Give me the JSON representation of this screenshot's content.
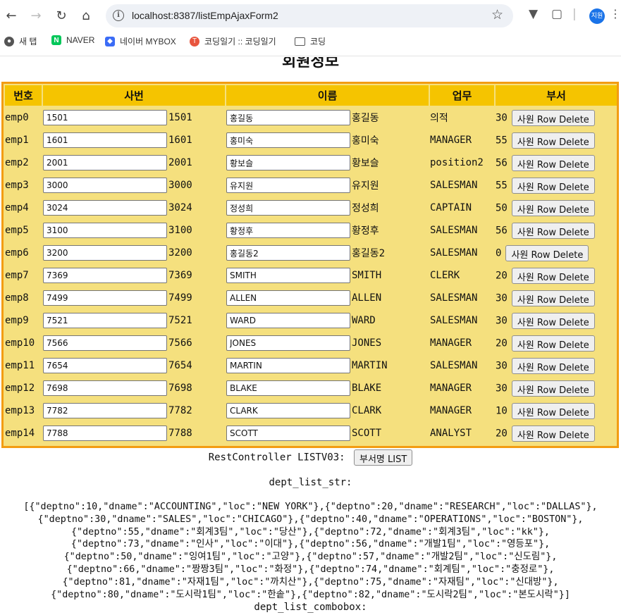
{
  "browser": {
    "url": "localhost:8387/listEmpAjaxForm2",
    "profile_label": "지원",
    "bookmarks": [
      {
        "label": "새 탭",
        "icon": "globe-icon"
      },
      {
        "label": "NAVER",
        "icon": "naver-icon"
      },
      {
        "label": "네이버 MYBOX",
        "icon": "mybox-icon"
      },
      {
        "label": "코딩일기 :: 코딩일기",
        "icon": "tistory-icon"
      },
      {
        "label": "코딩",
        "icon": "folder-icon"
      }
    ]
  },
  "page": {
    "title": "회원정보",
    "headers": [
      "번호",
      "사번",
      "이름",
      "업무",
      "부서"
    ],
    "delete_label": "사원 Row Delete",
    "rows": [
      {
        "no": "emp0",
        "empno": "1501",
        "ename": "홍길동",
        "job": "의적",
        "dept": "30"
      },
      {
        "no": "emp1",
        "empno": "1601",
        "ename": "홍미숙",
        "job": "MANAGER",
        "dept": "55"
      },
      {
        "no": "emp2",
        "empno": "2001",
        "ename": "황보슬",
        "job": "position2",
        "dept": "56"
      },
      {
        "no": "emp3",
        "empno": "3000",
        "ename": "유지원",
        "job": "SALESMAN",
        "dept": "55"
      },
      {
        "no": "emp4",
        "empno": "3024",
        "ename": "정성희",
        "job": "CAPTAIN",
        "dept": "50"
      },
      {
        "no": "emp5",
        "empno": "3100",
        "ename": "황정후",
        "job": "SALESMAN",
        "dept": "56"
      },
      {
        "no": "emp6",
        "empno": "3200",
        "ename": "홍길동2",
        "job": "SALESMAN",
        "dept": "0"
      },
      {
        "no": "emp7",
        "empno": "7369",
        "ename": "SMITH",
        "job": "CLERK",
        "dept": "20"
      },
      {
        "no": "emp8",
        "empno": "7499",
        "ename": "ALLEN",
        "job": "SALESMAN",
        "dept": "30"
      },
      {
        "no": "emp9",
        "empno": "7521",
        "ename": "WARD",
        "job": "SALESMAN",
        "dept": "30"
      },
      {
        "no": "emp10",
        "empno": "7566",
        "ename": "JONES",
        "job": "MANAGER",
        "dept": "20"
      },
      {
        "no": "emp11",
        "empno": "7654",
        "ename": "MARTIN",
        "job": "SALESMAN",
        "dept": "30"
      },
      {
        "no": "emp12",
        "empno": "7698",
        "ename": "BLAKE",
        "job": "MANAGER",
        "dept": "30"
      },
      {
        "no": "emp13",
        "empno": "7782",
        "ename": "CLARK",
        "job": "MANAGER",
        "dept": "10"
      },
      {
        "no": "emp14",
        "empno": "7788",
        "ename": "SCOTT",
        "job": "ANALYST",
        "dept": "20"
      }
    ],
    "rest_label": "RestController LISTV03:",
    "dept_button": "부서명 LIST",
    "dept_list_str_label": "dept_list_str:",
    "dept_list_str": "[{\"deptno\":10,\"dname\":\"ACCOUNTING\",\"loc\":\"NEW YORK\"},{\"deptno\":20,\"dname\":\"RESEARCH\",\"loc\":\"DALLAS\"},{\"deptno\":30,\"dname\":\"SALES\",\"loc\":\"CHICAGO\"},{\"deptno\":40,\"dname\":\"OPERATIONS\",\"loc\":\"BOSTON\"},{\"deptno\":55,\"dname\":\"회계3팀\",\"loc\":\"당산\"},{\"deptno\":72,\"dname\":\"회계3팀\",\"loc\":\"kk\"},{\"deptno\":73,\"dname\":\"인사\",\"loc\":\"이대\"},{\"deptno\":56,\"dname\":\"개발1팀\",\"loc\":\"영등포\"},{\"deptno\":50,\"dname\":\"잉여1팀\",\"loc\":\"고양\"},{\"deptno\":57,\"dname\":\"개발2팀\",\"loc\":\"신도림\"},{\"deptno\":66,\"dname\":\"짱짱3팀\",\"loc\":\"화정\"},{\"deptno\":74,\"dname\":\"회계팀\",\"loc\":\"충정로\"},{\"deptno\":81,\"dname\":\"자재1팀\",\"loc\":\"까치산\"},{\"deptno\":75,\"dname\":\"자재팀\",\"loc\":\"신대방\"},{\"deptno\":80,\"dname\":\"도시락1팀\",\"loc\":\"한솥\"},{\"deptno\":82,\"dname\":\"도시락2팀\",\"loc\":\"본도시락\"}]",
    "dept_list_combobox_label": "dept_list_combobox:"
  }
}
